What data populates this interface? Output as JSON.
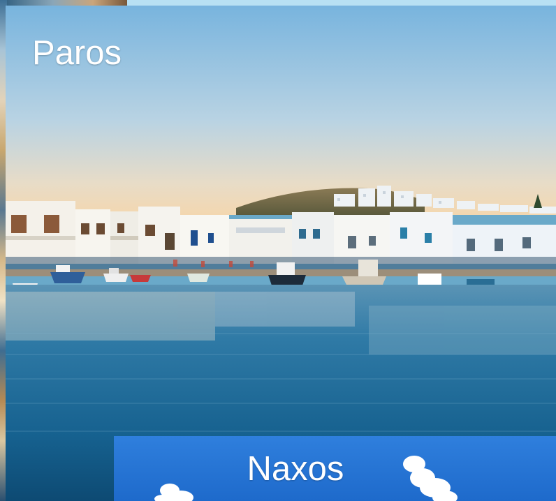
{
  "cards": [
    {
      "title": "Paros"
    },
    {
      "title": "Naxos"
    }
  ],
  "colors": {
    "sky_top": "#7fb8e0",
    "sky_bottom": "#f2d9b6",
    "sea_top": "#3f86b3",
    "sea_bottom": "#0f4f78",
    "naxos_sky": "#1f6ed0",
    "title_text": "#ffffff"
  },
  "icons": {
    "background_card": "photo-thumbnail",
    "paros_image": "harbor-photo",
    "naxos_image": "sky-clouds-photo"
  }
}
